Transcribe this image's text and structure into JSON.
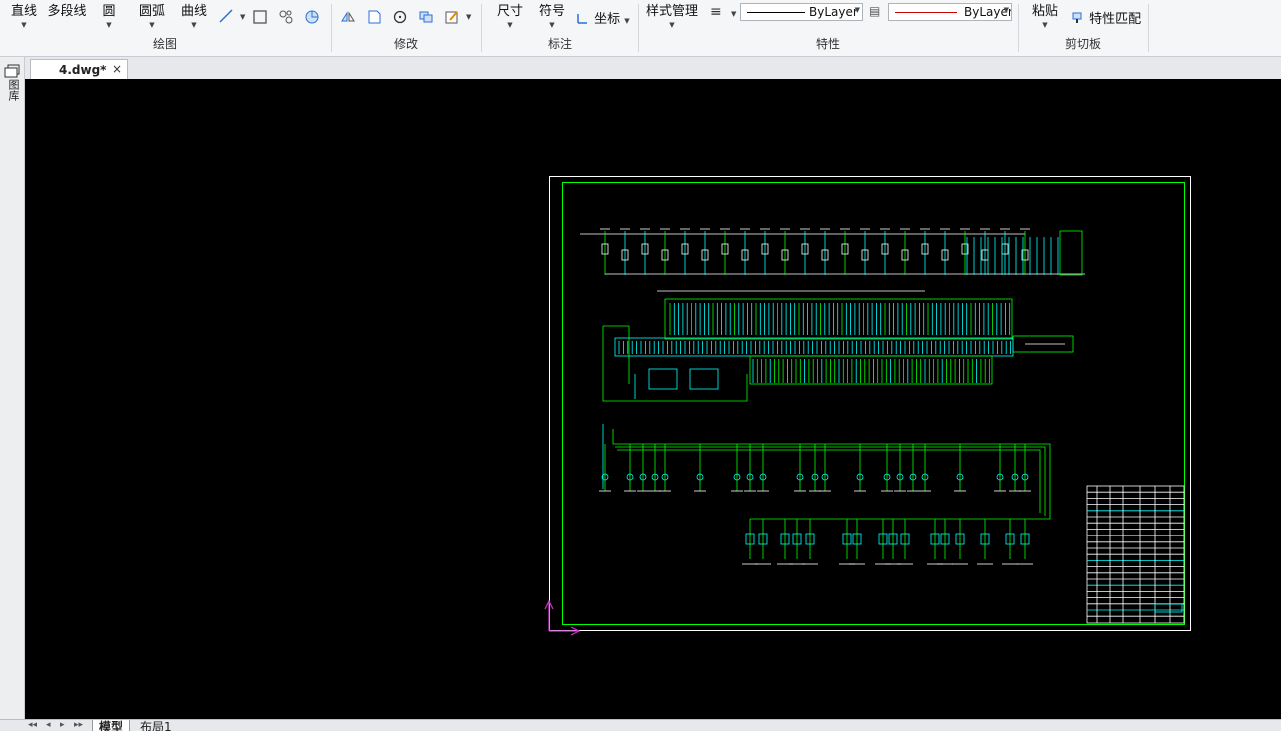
{
  "ribbon": {
    "draw": {
      "group_label": "绘图",
      "line_label": "直线",
      "polyline_label": "多段线",
      "circle_label": "圆",
      "arc_label": "圆弧",
      "curve_label": "曲线"
    },
    "modify": {
      "group_label": "修改"
    },
    "annotate": {
      "group_label": "标注",
      "dimension_label": "尺寸",
      "symbol_label": "符号",
      "coordinate_label": "坐标"
    },
    "properties": {
      "group_label": "特性",
      "style_manager_label": "样式管理",
      "linetype_value": "ByLayer",
      "color_value": "ByLayer"
    },
    "clipboard": {
      "group_label": "剪切板",
      "paste_label": "粘贴",
      "match_label": "特性匹配"
    }
  },
  "document_tab": {
    "name": "4.dwg*",
    "close_glyph": "×"
  },
  "left_palette": {
    "label": "图库"
  },
  "layout_tabs": {
    "model_label": "模型",
    "layout1_label": "布局1"
  },
  "nav_glyphs": {
    "first": "◂◂",
    "prev": "◂",
    "next": "▸",
    "last": "▸▸"
  },
  "colors": {
    "canvas": "#000000",
    "sheet_border": "#ffffff",
    "drawing_frame": "#00ff00",
    "schematic_cyan": "#00ffff",
    "schematic_green": "#00ff00",
    "schematic_white": "#ffffff",
    "ucs_icon": "#cc33cc",
    "linetype_line": "#000000",
    "color_line": "#cc0000"
  }
}
